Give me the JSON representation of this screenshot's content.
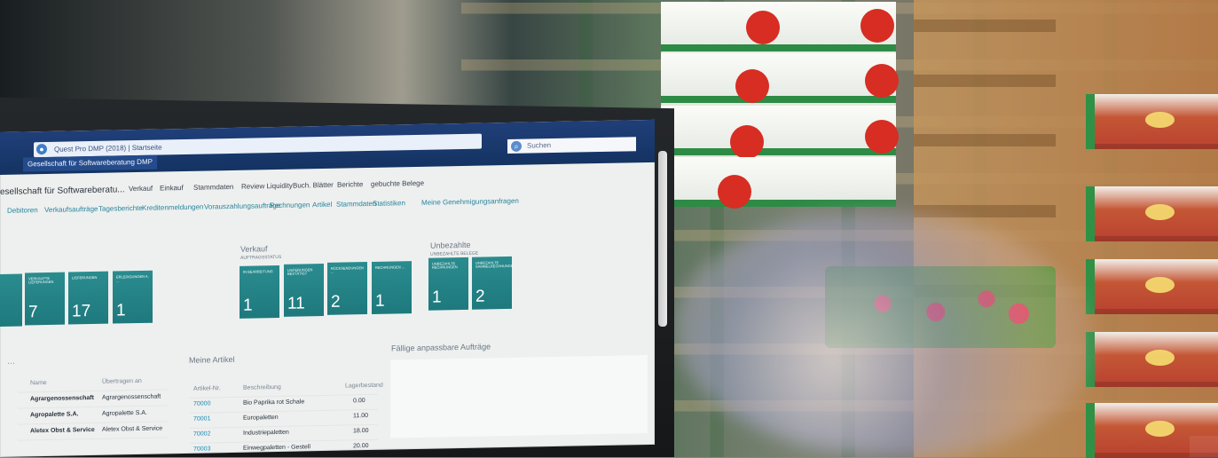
{
  "browser": {
    "address": "Quest Pro DMP (2018) | Startseite",
    "tab": "Gesellschaft für Softwareberatung DMP",
    "search": "Suchen"
  },
  "page": {
    "title": "esellschaft für Softwareberatu...",
    "nav_items": [
      "Verkauf",
      "Einkauf",
      "Stammdaten",
      "Review Liquidity",
      "Buch. Blätter",
      "Berichte",
      "gebuchte Belege"
    ],
    "sub_items": [
      "Debitoren",
      "Verkaufsaufträge",
      "Tagesberichte",
      "Kreditenmeldungen",
      "Vorauszahlungsaufträge",
      "Rechnungen",
      "Artikel",
      "Stammdaten",
      "Statistiken",
      "Meine Genehmigungsanfragen"
    ]
  },
  "sections": {
    "left_heading": "Verkauf",
    "left_subheading": "AUFTRAGSSTATUS",
    "right_heading": "Unbezahlte",
    "right_subheading": "UNBEZAHLTE BELEGE",
    "articles_heading": "Meine Artikel",
    "assignments_heading": "Fällige anpassbare Aufträge"
  },
  "tiles": [
    {
      "label": "",
      "value": ""
    },
    {
      "label": "Verkaufte Lieferungen",
      "value": "7"
    },
    {
      "label": "Lieferungen",
      "value": "17"
    },
    {
      "label": "Erledigungen a. ...",
      "value": "1"
    },
    {
      "label": "In Bearbeitung",
      "value": "1"
    },
    {
      "label": "Lieferungen bestätigt",
      "value": "11"
    },
    {
      "label": "Rücksendungen ...",
      "value": "2"
    },
    {
      "label": "Rechnungen ...",
      "value": "1"
    },
    {
      "label": "Unbezahlte Rechnungen",
      "value": "1"
    },
    {
      "label": "Unbezahlte Sammelrechnungen",
      "value": "2"
    }
  ],
  "customers": {
    "headers": [
      "Name",
      "Übertragen an"
    ],
    "rows": [
      {
        "name": "Agrargenossenschaft",
        "value": "Agrargenossenschaft"
      },
      {
        "name": "Agropalette S.A.",
        "value": "Agropalette S.A."
      },
      {
        "name": "Aletex Obst & Service",
        "value": "Aletex Obst & Service"
      }
    ]
  },
  "articles": {
    "headers": [
      "Artikel-Nr.",
      "Beschreibung",
      "Lagerbestand"
    ],
    "rows": [
      {
        "no": "70000",
        "desc": "Bio Paprika rot Schale",
        "stock": "0.00"
      },
      {
        "no": "70001",
        "desc": "Europaletten",
        "stock": "11.00"
      },
      {
        "no": "70002",
        "desc": "Industriepaletten",
        "stock": "18.00"
      },
      {
        "no": "70003",
        "desc": "Einwegpaletten - Gestell",
        "stock": "20.00"
      }
    ]
  }
}
